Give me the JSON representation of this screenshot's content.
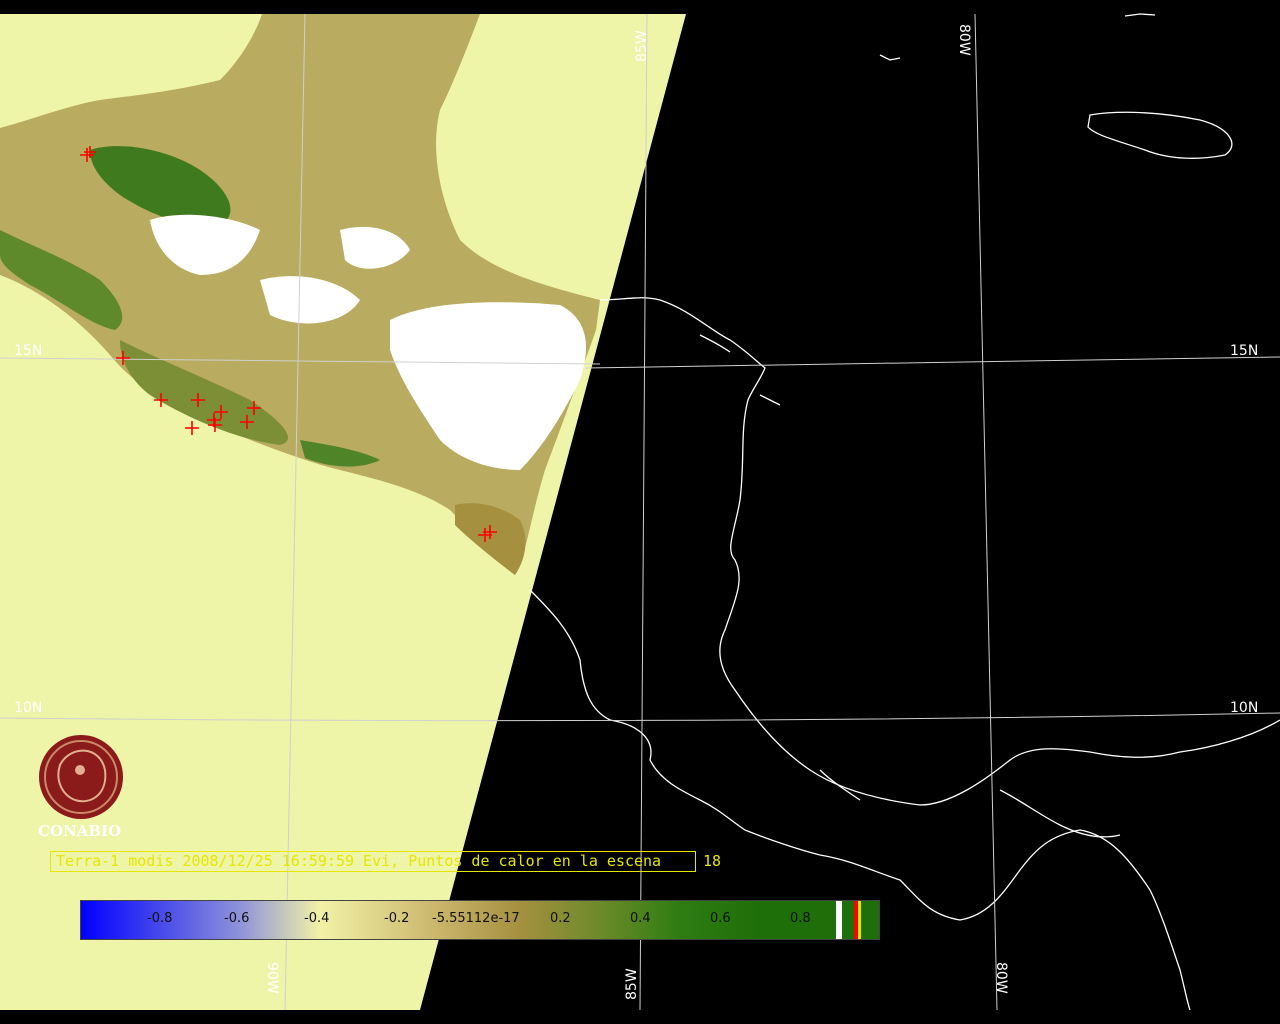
{
  "map": {
    "lat_labels": [
      "15N",
      "15N",
      "10N",
      "10N"
    ],
    "lon_labels": [
      "85W",
      "80W",
      "90W",
      "85W",
      "80W"
    ],
    "logo_text": "CONABIO",
    "caption": "Terra-1 modis 2008/12/25 16:59:59 Evi, Puntos de calor en la escena",
    "hotspot_count": "18",
    "colors": {
      "background": "#000000",
      "no_data": "#eef5a8",
      "coastline": "#ffffff",
      "grid": "#cfcfcf",
      "hotspot": "#ff0000",
      "caption": "#e6e600",
      "logo": "#8b1a1a"
    }
  },
  "legend": {
    "labels": [
      "-0.8",
      "-0.6",
      "-0.4",
      "-0.2",
      "-5.55112e-17",
      "0.2",
      "0.4",
      "0.6",
      "0.8"
    ],
    "colors": [
      "#0000ff",
      "#8f93d8",
      "#f2f2a6",
      "#c9b46a",
      "#a59040",
      "#6e8a2a",
      "#2f7d12",
      "#1e6e0a"
    ],
    "swatch_colors": [
      "#ffffff",
      "#1e6e0a",
      "#ff0000",
      "#e6e600",
      "#1e6e0a"
    ]
  }
}
